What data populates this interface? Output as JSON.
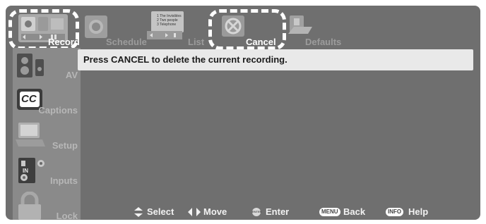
{
  "tabs": [
    {
      "label": "Record",
      "icon": "record-icon",
      "active": true
    },
    {
      "label": "Schedule",
      "icon": "schedule-icon",
      "active": false
    },
    {
      "label": "List",
      "icon": "list-icon",
      "active": false,
      "icon_text": [
        "1 The Invisibles",
        "2 Two people",
        "3 Telephone"
      ]
    },
    {
      "label": "Cancel",
      "icon": "cancel-icon",
      "active": true
    },
    {
      "label": "Defaults",
      "icon": "defaults-icon",
      "active": false
    }
  ],
  "sidebar": {
    "items": [
      {
        "label": "AV",
        "icon": "speaker-icon"
      },
      {
        "label": "Captions",
        "icon": "cc-icon",
        "icon_text": "CC"
      },
      {
        "label": "Setup",
        "icon": "monitor-icon"
      },
      {
        "label": "Inputs",
        "icon": "inputs-icon",
        "icon_text": "IN"
      },
      {
        "label": "Lock",
        "icon": "lock-icon"
      }
    ]
  },
  "message": "Press CANCEL to delete the current recording.",
  "hints": [
    {
      "label": "Select",
      "icon": "updown-arrows-icon"
    },
    {
      "label": "Move",
      "icon": "leftright-arrows-icon"
    },
    {
      "label": "Enter",
      "icon": "enter-button-icon",
      "key": "ENTER"
    },
    {
      "label": "Back",
      "icon": "menu-key-icon",
      "key": "MENU"
    },
    {
      "label": "Help",
      "icon": "info-key-icon",
      "key": "INFO"
    }
  ],
  "colors": {
    "background": "#6f6f6f",
    "sidebar": "#8a8a8a",
    "message_bar": "#e9e9e9",
    "active_text": "#ffffff",
    "inactive_text": "#9c9c9c"
  }
}
